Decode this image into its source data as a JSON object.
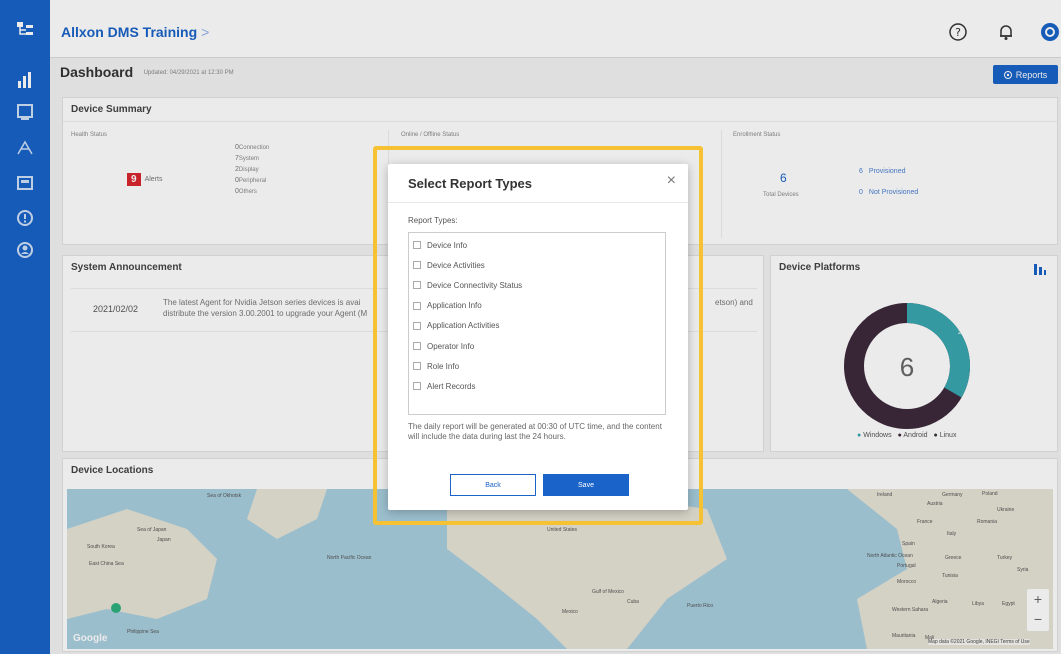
{
  "header": {
    "app_title": "Allxon DMS Training",
    "breadcrumb_chevron": ">"
  },
  "dashboard": {
    "title": "Dashboard",
    "updated": "Updated: 04/29/2021 at 12:30 PM",
    "reports_label": "Reports"
  },
  "device_summary": {
    "title": "Device Summary",
    "health_status_label": "Health Status",
    "alerts_count": "9",
    "alerts_label": "Alerts",
    "health_items": [
      {
        "count": "0",
        "label": "Connection"
      },
      {
        "count": "7",
        "label": "System"
      },
      {
        "count": "2",
        "label": "Display"
      },
      {
        "count": "0",
        "label": "Peripheral"
      },
      {
        "count": "0",
        "label": "Others"
      }
    ],
    "online_offline_label": "Online / Offline Status",
    "enrollment_label": "Enrollment Status",
    "total_devices_count": "6",
    "total_devices_label": "Total Devices",
    "provisioned_count": "6",
    "provisioned_label": "Provisioned",
    "not_provisioned_count": "0",
    "not_provisioned_label": "Not Provisioned"
  },
  "announcement": {
    "title": "System Announcement",
    "date": "2021/02/02",
    "text_line1": "The latest Agent for Nvidia Jetson series devices is avai",
    "text_line1_tail": "etson) and",
    "text_line2": "distribute the version 3.00.2001 to upgrade your Agent (M"
  },
  "platforms": {
    "title": "Device Platforms",
    "center_total": "6",
    "slice_windows_label": "2",
    "slice_android_label": "4",
    "legend": [
      "Windows",
      "Android",
      "Linux"
    ],
    "colors": {
      "windows": "#3aa7b0",
      "android": "#3d2a3c",
      "linux": "#333333"
    }
  },
  "locations": {
    "title": "Device Locations",
    "google_label": "Google",
    "map_footer": "Map data ©2021 Google, INEGI  Terms of Use",
    "map_labels": [
      "Sea of Okhotsk",
      "Sea of Japan",
      "Japan",
      "South Korea",
      "East China Sea",
      "Philippine Sea",
      "North Pacific Ocean",
      "United States",
      "Gulf of Mexico",
      "Mexico",
      "Cuba",
      "Puerto Rico",
      "North Atlantic Ocean",
      "Morocco",
      "Algeria",
      "Libya",
      "Egypt",
      "Spain",
      "Portugal",
      "France",
      "Germany",
      "Poland",
      "Ukraine",
      "Romania",
      "Turkey",
      "Ireland",
      "Greece",
      "Mali",
      "Mauritania",
      "Western Sahara",
      "Italy",
      "Austria",
      "Tunisia",
      "Syria"
    ]
  },
  "modal": {
    "title": "Select Report Types",
    "close": "×",
    "label": "Report Types:",
    "options": [
      "Device Info",
      "Device Activities",
      "Device Connectivity Status",
      "Application Info",
      "Application Activities",
      "Operator Info",
      "Role Info",
      "Alert Records"
    ],
    "note": "The daily report will be generated at 00:30 of UTC time, and the content will include the data during last the 24 hours.",
    "back_label": "Back",
    "save_label": "Save"
  },
  "colors": {
    "brand": "#1a63c8",
    "highlight": "#f6c233",
    "alert": "#d9272e"
  },
  "icons": [
    "hierarchy-icon",
    "bar-chart-icon",
    "monitor-icon",
    "network-icon",
    "package-icon",
    "alert-icon",
    "user-icon",
    "help-icon",
    "bell-icon",
    "avatar-icon",
    "report-icon",
    "chart-toggle-icon",
    "map-marker-icon",
    "zoom-in-icon",
    "zoom-out-icon"
  ]
}
